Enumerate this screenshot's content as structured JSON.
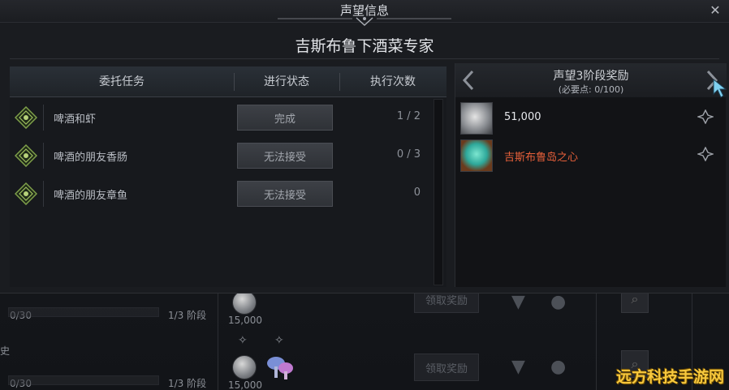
{
  "window": {
    "title": "声望信息",
    "close_symbol": "✕",
    "faction_name": "吉斯布鲁下酒菜专家"
  },
  "quests_table": {
    "headers": [
      "委托任务",
      "进行状态",
      "执行次数"
    ],
    "rows": [
      {
        "name": "啤酒和虾",
        "status": "完成",
        "count": "1 / 2",
        "icon": "quest-emblem-icon"
      },
      {
        "name": "啤酒的朋友香肠",
        "status": "无法接受",
        "count": "0 / 3",
        "icon": "quest-emblem-icon"
      },
      {
        "name": "啤酒的朋友章鱼",
        "status": "无法接受",
        "count": "0",
        "icon": "quest-emblem-icon"
      }
    ]
  },
  "reward_panel": {
    "stage_title": "声望3阶段奖励",
    "requirement": "(必要点: 0/100)",
    "prev_icon": "chevron-left-icon",
    "next_icon": "chevron-right-icon",
    "rewards": [
      {
        "label": "51,000",
        "icon": "silver-coin-icon",
        "color": "#e6e8ec"
      },
      {
        "label": "吉斯布鲁岛之心",
        "icon": "island-heart-icon",
        "color": "#e8603a"
      }
    ]
  },
  "background": {
    "rows": [
      {
        "progress_text": "0/30",
        "stage_text": "1/3 阶段",
        "coin_amount": "15,000",
        "claim_label": "领取奖励"
      },
      {
        "side_text": "史",
        "progress_text": "0/30",
        "stage_text": "1/3 阶段",
        "coin_amount": "15,000",
        "claim_label": "领取奖励"
      }
    ]
  },
  "watermark": "远方科技手游网"
}
